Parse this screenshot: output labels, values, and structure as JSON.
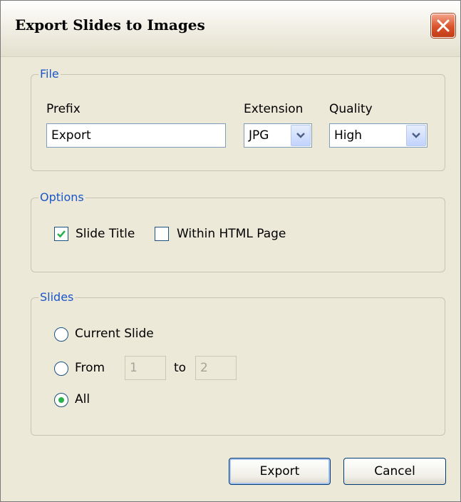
{
  "dialog": {
    "title": "Export Slides to Images"
  },
  "file": {
    "legend": "File",
    "prefix_label": "Prefix",
    "prefix_value": "Export",
    "extension_label": "Extension",
    "extension_value": "JPG",
    "quality_label": "Quality",
    "quality_value": "High"
  },
  "options": {
    "legend": "Options",
    "slide_title_label": "Slide Title",
    "slide_title_checked": true,
    "within_html_label": "Within HTML Page",
    "within_html_checked": false
  },
  "slides": {
    "legend": "Slides",
    "current_label": "Current Slide",
    "from_label": "From",
    "from_value": "1",
    "to_label": "to",
    "to_value": "2",
    "all_label": "All",
    "selected": "all"
  },
  "buttons": {
    "export_label": "Export",
    "cancel_label": "Cancel"
  },
  "colors": {
    "legend": "#1a56c9",
    "check": "#2bb14a",
    "close": "#d9532c"
  }
}
